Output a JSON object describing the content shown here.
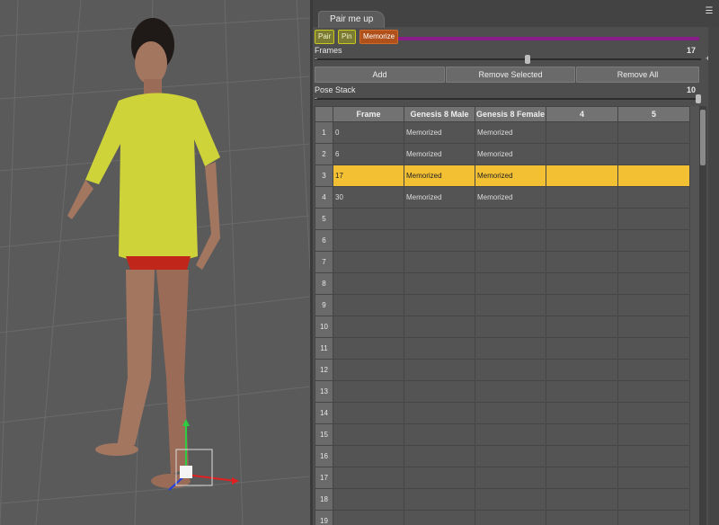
{
  "tab": {
    "title": "Pair me up"
  },
  "toolbar": {
    "pair_label": "Pair",
    "pin_label": "Pin",
    "memorize_label": "Memorize"
  },
  "frames": {
    "label": "Frames",
    "value": "17",
    "minus": "-",
    "plus": "+",
    "fraction": 0.55
  },
  "actions": {
    "add_label": "Add",
    "remove_selected_label": "Remove Selected",
    "remove_all_label": "Remove All"
  },
  "pose_stack": {
    "label": "Pose Stack",
    "value": "10",
    "minus": "-",
    "fraction": 1.0
  },
  "table": {
    "columns": [
      "",
      "Frame",
      "Genesis 8 Male",
      "Genesis 8 Female",
      "4",
      "5"
    ],
    "selected_row": 3,
    "rows": [
      [
        "1",
        "0",
        "Memorized",
        "Memorized",
        "",
        ""
      ],
      [
        "2",
        "6",
        "Memorized",
        "Memorized",
        "",
        ""
      ],
      [
        "3",
        "17",
        "Memorized",
        "Memorized",
        "",
        ""
      ],
      [
        "4",
        "30",
        "Memorized",
        "Memorized",
        "",
        ""
      ],
      [
        "5",
        "",
        "",
        "",
        "",
        ""
      ],
      [
        "6",
        "",
        "",
        "",
        "",
        ""
      ],
      [
        "7",
        "",
        "",
        "",
        "",
        ""
      ],
      [
        "8",
        "",
        "",
        "",
        "",
        ""
      ],
      [
        "9",
        "",
        "",
        "",
        "",
        ""
      ],
      [
        "10",
        "",
        "",
        "",
        "",
        ""
      ],
      [
        "11",
        "",
        "",
        "",
        "",
        ""
      ],
      [
        "12",
        "",
        "",
        "",
        "",
        ""
      ],
      [
        "13",
        "",
        "",
        "",
        "",
        ""
      ],
      [
        "14",
        "",
        "",
        "",
        "",
        ""
      ],
      [
        "15",
        "",
        "",
        "",
        "",
        ""
      ],
      [
        "16",
        "",
        "",
        "",
        "",
        ""
      ],
      [
        "17",
        "",
        "",
        "",
        "",
        ""
      ],
      [
        "18",
        "",
        "",
        "",
        "",
        ""
      ],
      [
        "19",
        "",
        "",
        "",
        "",
        ""
      ]
    ]
  },
  "colors": {
    "selection": "#f3c034",
    "memorize_accent": "#b0501a",
    "pair_accent": "#c8c81e",
    "purple_bar": "#8a1c8a"
  },
  "icons": {
    "panel_menu": "menu-lines-icon"
  }
}
